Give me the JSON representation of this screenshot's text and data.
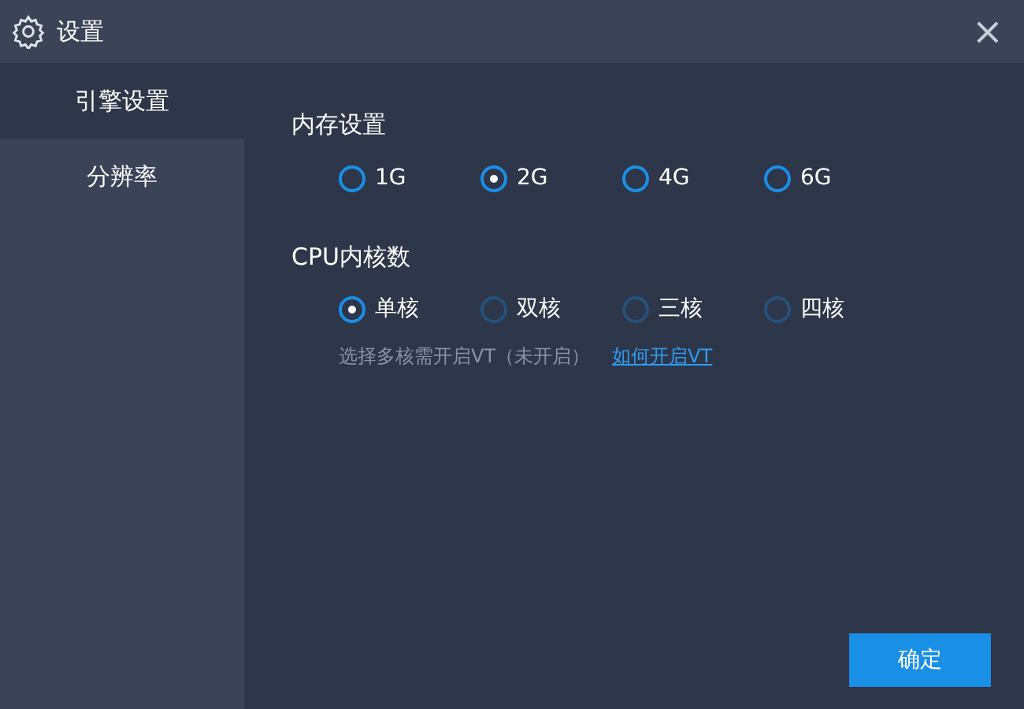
{
  "window": {
    "title": "设置",
    "close": "×"
  },
  "sidebar": {
    "items": [
      {
        "label": "引擎设置",
        "selected": true
      },
      {
        "label": "分辨率",
        "selected": false
      }
    ]
  },
  "memory": {
    "title": "内存设置",
    "options": [
      {
        "label": "1G",
        "selected": false,
        "disabled": false
      },
      {
        "label": "2G",
        "selected": true,
        "disabled": false
      },
      {
        "label": "4G",
        "selected": false,
        "disabled": false
      },
      {
        "label": "6G",
        "selected": false,
        "disabled": false
      }
    ]
  },
  "cpu": {
    "title": "CPU内核数",
    "options": [
      {
        "label": "单核",
        "selected": true,
        "disabled": false
      },
      {
        "label": "双核",
        "selected": false,
        "disabled": true
      },
      {
        "label": "三核",
        "selected": false,
        "disabled": true
      },
      {
        "label": "四核",
        "selected": false,
        "disabled": true
      }
    ],
    "hint": "选择多核需开启VT（未开启）",
    "link": "如何开启VT"
  },
  "buttons": [
    "确定"
  ]
}
